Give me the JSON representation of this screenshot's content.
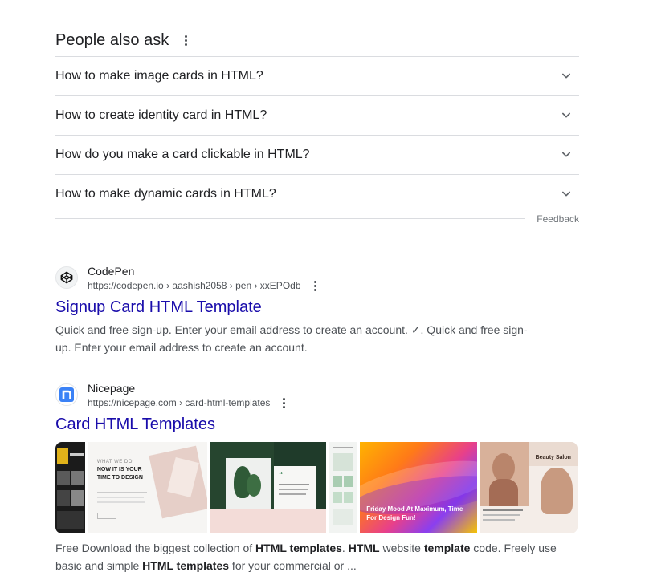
{
  "paa": {
    "title": "People also ask",
    "questions": [
      "How to make image cards in HTML?",
      "How to create identity card in HTML?",
      "How do you make a card clickable in HTML?",
      "How to make dynamic cards in HTML?"
    ],
    "feedback": "Feedback"
  },
  "results": [
    {
      "site": "CodePen",
      "url": "https://codepen.io › aashish2058 › pen › xxEPOdb",
      "title": "Signup Card HTML Template",
      "snippet": "Quick and free sign-up. Enter your email address to create an account. ✓. Quick and free sign-up. Enter your email address to create an account."
    },
    {
      "site": "Nicepage",
      "url": "https://nicepage.com › card-html-templates",
      "title": "Card HTML Templates",
      "snippet_parts": [
        "Free Download the biggest collection of ",
        "HTML templates",
        ". ",
        "HTML",
        " website ",
        "template",
        " code. Freely use basic and simple ",
        "HTML templates",
        " for your commercial or ..."
      ],
      "thumbs": {
        "t2_a": "WHAT WE DO",
        "t2_b": "NOW IT IS YOUR TIME TO DESIGN",
        "t5": "Friday Mood At Maximum, Time For Design Fun!",
        "t6": "Beauty Salon"
      }
    }
  ]
}
